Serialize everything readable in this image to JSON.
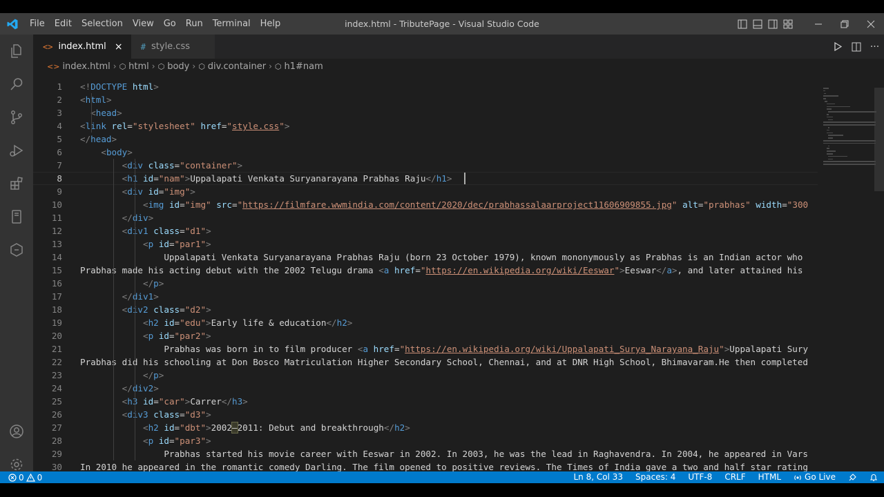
{
  "window": {
    "title": "index.html - TributePage - Visual Studio Code",
    "menu": [
      "File",
      "Edit",
      "Selection",
      "View",
      "Go",
      "Run",
      "Terminal",
      "Help"
    ]
  },
  "tabs": [
    {
      "icon": "<>",
      "label": "index.html",
      "active": true,
      "close": "×"
    },
    {
      "icon": "#",
      "label": "style.css",
      "active": false
    }
  ],
  "breadcrumb": [
    "index.html",
    "html",
    "body",
    "div.container",
    "h1#nam"
  ],
  "editor": {
    "current_line": 8,
    "lines": [
      {
        "n": "1",
        "tokens": [
          [
            "p",
            "<!"
          ],
          [
            "tag",
            "DOCTYPE"
          ],
          [
            "t",
            " "
          ],
          [
            "attr",
            "html"
          ],
          [
            "p",
            ">"
          ]
        ]
      },
      {
        "n": "2",
        "tokens": [
          [
            "p",
            "<"
          ],
          [
            "tag",
            "html"
          ],
          [
            "p",
            ">"
          ]
        ]
      },
      {
        "n": "3",
        "tokens": [
          [
            "t",
            "  "
          ],
          [
            "p",
            "<"
          ],
          [
            "tag",
            "head"
          ],
          [
            "p",
            ">"
          ]
        ]
      },
      {
        "n": "4",
        "tokens": [
          [
            "p",
            "<"
          ],
          [
            "tag",
            "link"
          ],
          [
            "t",
            " "
          ],
          [
            "attr",
            "rel"
          ],
          [
            "t",
            "="
          ],
          [
            "str",
            "\"stylesheet\""
          ],
          [
            "t",
            " "
          ],
          [
            "attr",
            "href"
          ],
          [
            "t",
            "="
          ],
          [
            "str",
            "\""
          ],
          [
            "url",
            "style.css"
          ],
          [
            "str",
            "\""
          ],
          [
            "p",
            ">"
          ]
        ]
      },
      {
        "n": "5",
        "tokens": [
          [
            "p",
            "</"
          ],
          [
            "tag",
            "head"
          ],
          [
            "p",
            ">"
          ]
        ]
      },
      {
        "n": "6",
        "tokens": [
          [
            "t",
            "    "
          ],
          [
            "p",
            "<"
          ],
          [
            "tag",
            "body"
          ],
          [
            "p",
            ">"
          ]
        ]
      },
      {
        "n": "7",
        "tokens": [
          [
            "t",
            "        "
          ],
          [
            "p",
            "<"
          ],
          [
            "tag",
            "div"
          ],
          [
            "t",
            " "
          ],
          [
            "attr",
            "class"
          ],
          [
            "t",
            "="
          ],
          [
            "str",
            "\"container\""
          ],
          [
            "p",
            ">"
          ]
        ]
      },
      {
        "n": "8",
        "tokens": [
          [
            "t",
            "        "
          ],
          [
            "p",
            "<"
          ],
          [
            "tag",
            "h1"
          ],
          [
            "t",
            " "
          ],
          [
            "attr",
            "id"
          ],
          [
            "t",
            "="
          ],
          [
            "str",
            "\"nam\""
          ],
          [
            "p",
            ">"
          ],
          [
            "t",
            "Uppalapati Venkata Suryanarayana Prabhas Raju"
          ],
          [
            "p",
            "</"
          ],
          [
            "tag",
            "h1"
          ],
          [
            "p",
            ">"
          ]
        ]
      },
      {
        "n": "9",
        "tokens": [
          [
            "t",
            "        "
          ],
          [
            "p",
            "<"
          ],
          [
            "tag",
            "div"
          ],
          [
            "t",
            " "
          ],
          [
            "attr",
            "id"
          ],
          [
            "t",
            "="
          ],
          [
            "str",
            "\"img\""
          ],
          [
            "p",
            ">"
          ]
        ]
      },
      {
        "n": "10",
        "tokens": [
          [
            "t",
            "            "
          ],
          [
            "p",
            "<"
          ],
          [
            "tag",
            "img"
          ],
          [
            "t",
            " "
          ],
          [
            "attr",
            "id"
          ],
          [
            "t",
            "="
          ],
          [
            "str",
            "\"img\""
          ],
          [
            "t",
            " "
          ],
          [
            "attr",
            "src"
          ],
          [
            "t",
            "="
          ],
          [
            "str",
            "\""
          ],
          [
            "url",
            "https://filmfare.wwmindia.com/content/2020/dec/prabhassalaarproject11606909855.jpg"
          ],
          [
            "str",
            "\""
          ],
          [
            "t",
            " "
          ],
          [
            "attr",
            "alt"
          ],
          [
            "t",
            "="
          ],
          [
            "str",
            "\"prabhas\""
          ],
          [
            "t",
            " "
          ],
          [
            "attr",
            "width"
          ],
          [
            "t",
            "="
          ],
          [
            "str",
            "\"300"
          ]
        ]
      },
      {
        "n": "11",
        "tokens": [
          [
            "t",
            "        "
          ],
          [
            "p",
            "</"
          ],
          [
            "tag",
            "div"
          ],
          [
            "p",
            ">"
          ]
        ]
      },
      {
        "n": "12",
        "tokens": [
          [
            "t",
            "        "
          ],
          [
            "p",
            "<"
          ],
          [
            "tag",
            "div1"
          ],
          [
            "t",
            " "
          ],
          [
            "attr",
            "class"
          ],
          [
            "t",
            "="
          ],
          [
            "str",
            "\"d1\""
          ],
          [
            "p",
            ">"
          ]
        ]
      },
      {
        "n": "13",
        "tokens": [
          [
            "t",
            "            "
          ],
          [
            "p",
            "<"
          ],
          [
            "tag",
            "p"
          ],
          [
            "t",
            " "
          ],
          [
            "attr",
            "id"
          ],
          [
            "t",
            "="
          ],
          [
            "str",
            "\"par1\""
          ],
          [
            "p",
            ">"
          ]
        ]
      },
      {
        "n": "14",
        "tokens": [
          [
            "t",
            "                Uppalapati Venkata Suryanarayana Prabhas Raju (born 23 October 1979), known mononymously as Prabhas is an Indian actor who"
          ]
        ]
      },
      {
        "n": "15",
        "tokens": [
          [
            "t",
            "Prabhas made his acting debut with the 2002 Telugu drama "
          ],
          [
            "p",
            "<"
          ],
          [
            "tag",
            "a"
          ],
          [
            "t",
            " "
          ],
          [
            "attr",
            "href"
          ],
          [
            "t",
            "="
          ],
          [
            "str",
            "\""
          ],
          [
            "url",
            "https://en.wikipedia.org/wiki/Eeswar"
          ],
          [
            "str",
            "\""
          ],
          [
            "p",
            ">"
          ],
          [
            "t",
            "Eeswar"
          ],
          [
            "p",
            "</"
          ],
          [
            "tag",
            "a"
          ],
          [
            "p",
            ">"
          ],
          [
            "t",
            ", and later attained his"
          ]
        ]
      },
      {
        "n": "16",
        "tokens": [
          [
            "t",
            "            "
          ],
          [
            "p",
            "</"
          ],
          [
            "tag",
            "p"
          ],
          [
            "p",
            ">"
          ]
        ]
      },
      {
        "n": "17",
        "tokens": [
          [
            "t",
            "        "
          ],
          [
            "p",
            "</"
          ],
          [
            "tag",
            "div1"
          ],
          [
            "p",
            ">"
          ]
        ]
      },
      {
        "n": "18",
        "tokens": [
          [
            "t",
            "        "
          ],
          [
            "p",
            "<"
          ],
          [
            "tag",
            "div2"
          ],
          [
            "t",
            " "
          ],
          [
            "attr",
            "class"
          ],
          [
            "t",
            "="
          ],
          [
            "str",
            "\"d2\""
          ],
          [
            "p",
            ">"
          ]
        ]
      },
      {
        "n": "19",
        "tokens": [
          [
            "t",
            "            "
          ],
          [
            "p",
            "<"
          ],
          [
            "tag",
            "h2"
          ],
          [
            "t",
            " "
          ],
          [
            "attr",
            "id"
          ],
          [
            "t",
            "="
          ],
          [
            "str",
            "\"edu\""
          ],
          [
            "p",
            ">"
          ],
          [
            "t",
            "Early life & education"
          ],
          [
            "p",
            "</"
          ],
          [
            "tag",
            "h2"
          ],
          [
            "p",
            ">"
          ]
        ]
      },
      {
        "n": "20",
        "tokens": [
          [
            "t",
            "            "
          ],
          [
            "p",
            "<"
          ],
          [
            "tag",
            "p"
          ],
          [
            "t",
            " "
          ],
          [
            "attr",
            "id"
          ],
          [
            "t",
            "="
          ],
          [
            "str",
            "\"par2\""
          ],
          [
            "p",
            ">"
          ]
        ]
      },
      {
        "n": "21",
        "tokens": [
          [
            "t",
            "                Prabhas was born in to film producer "
          ],
          [
            "p",
            "<"
          ],
          [
            "tag",
            "a"
          ],
          [
            "t",
            " "
          ],
          [
            "attr",
            "href"
          ],
          [
            "t",
            "="
          ],
          [
            "str",
            "\""
          ],
          [
            "url",
            "https://en.wikipedia.org/wiki/Uppalapati_Surya_Narayana_Raju"
          ],
          [
            "str",
            "\""
          ],
          [
            "p",
            ">"
          ],
          [
            "t",
            "Uppalapati Sury"
          ]
        ]
      },
      {
        "n": "22",
        "tokens": [
          [
            "t",
            "Prabhas did his schooling at Don Bosco Matriculation Higher Secondary School, Chennai, and at DNR High School, Bhimavaram.He then completed"
          ]
        ]
      },
      {
        "n": "23",
        "tokens": [
          [
            "t",
            "            "
          ],
          [
            "p",
            "</"
          ],
          [
            "tag",
            "p"
          ],
          [
            "p",
            ">"
          ]
        ]
      },
      {
        "n": "24",
        "tokens": [
          [
            "t",
            "        "
          ],
          [
            "p",
            "</"
          ],
          [
            "tag",
            "div2"
          ],
          [
            "p",
            ">"
          ]
        ]
      },
      {
        "n": "25",
        "tokens": [
          [
            "t",
            "        "
          ],
          [
            "p",
            "<"
          ],
          [
            "tag",
            "h3"
          ],
          [
            "t",
            " "
          ],
          [
            "attr",
            "id"
          ],
          [
            "t",
            "="
          ],
          [
            "str",
            "\"car\""
          ],
          [
            "p",
            ">"
          ],
          [
            "t",
            "Carrer"
          ],
          [
            "p",
            "</"
          ],
          [
            "tag",
            "h3"
          ],
          [
            "p",
            ">"
          ]
        ]
      },
      {
        "n": "26",
        "tokens": [
          [
            "t",
            "        "
          ],
          [
            "p",
            "<"
          ],
          [
            "tag",
            "div3"
          ],
          [
            "t",
            " "
          ],
          [
            "attr",
            "class"
          ],
          [
            "t",
            "="
          ],
          [
            "str",
            "\"d3\""
          ],
          [
            "p",
            ">"
          ]
        ]
      },
      {
        "n": "27",
        "tokens": [
          [
            "t",
            "            "
          ],
          [
            "p",
            "<"
          ],
          [
            "tag",
            "h2"
          ],
          [
            "t",
            " "
          ],
          [
            "attr",
            "id"
          ],
          [
            "t",
            "="
          ],
          [
            "str",
            "\"dbt\""
          ],
          [
            "p",
            ">"
          ],
          [
            "t",
            "2002"
          ],
          [
            "hl",
            "–"
          ],
          [
            "t",
            "2011: Debut and breakthrough"
          ],
          [
            "p",
            "</"
          ],
          [
            "tag",
            "h2"
          ],
          [
            "p",
            ">"
          ]
        ]
      },
      {
        "n": "28",
        "tokens": [
          [
            "t",
            "            "
          ],
          [
            "p",
            "<"
          ],
          [
            "tag",
            "p"
          ],
          [
            "t",
            " "
          ],
          [
            "attr",
            "id"
          ],
          [
            "t",
            "="
          ],
          [
            "str",
            "\"par3\""
          ],
          [
            "p",
            ">"
          ]
        ]
      },
      {
        "n": "29",
        "tokens": [
          [
            "t",
            "                Prabhas started his movie career with Eeswar in 2002. In 2003, he was the lead in Raghavendra. In 2004, he appeared in Vars"
          ]
        ]
      },
      {
        "n": "30",
        "tokens": [
          [
            "t",
            "In 2010 he appeared in the romantic comedy Darling. The film opened to positive reviews. The Times of India gave a two and half star rating"
          ]
        ]
      }
    ]
  },
  "statusbar": {
    "errors": "0",
    "warnings": "0",
    "position": "Ln 8, Col 33",
    "spaces": "Spaces: 4",
    "encoding": "UTF-8",
    "eol": "CRLF",
    "language": "HTML",
    "golive": "Go Live"
  },
  "colors": {
    "titlebar": "#3c3c3c",
    "activitybar": "#333333",
    "editor": "#1e1e1e",
    "statusbar": "#007acc",
    "tag": "#569cd6",
    "attr": "#9cdcfe",
    "string": "#ce9178"
  }
}
